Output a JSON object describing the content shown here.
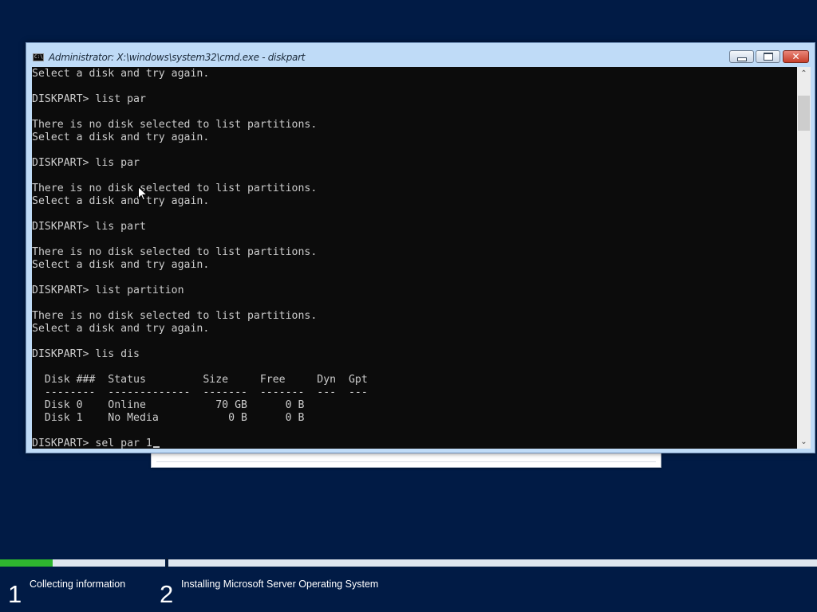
{
  "window": {
    "title": "Administrator: X:\\windows\\system32\\cmd.exe - diskpart",
    "icon": "cmd-app-icon",
    "minimize_icon": "minimize-icon",
    "maximize_icon": "maximize-icon",
    "close_icon": "close-icon"
  },
  "console": {
    "lines": [
      "Select a disk and try again.",
      "",
      "DISKPART> list par",
      "",
      "There is no disk selected to list partitions.",
      "Select a disk and try again.",
      "",
      "DISKPART> lis par",
      "",
      "There is no disk selected to list partitions.",
      "Select a disk and try again.",
      "",
      "DISKPART> lis part",
      "",
      "There is no disk selected to list partitions.",
      "Select a disk and try again.",
      "",
      "DISKPART> list partition",
      "",
      "There is no disk selected to list partitions.",
      "Select a disk and try again.",
      "",
      "DISKPART> lis dis",
      "",
      "  Disk ###  Status         Size     Free     Dyn  Gpt",
      "  --------  -------------  -------  -------  ---  ---",
      "  Disk 0    Online           70 GB      0 B",
      "  Disk 1    No Media           0 B      0 B",
      "",
      "DISKPART> sel par 1"
    ],
    "background": "#0c0c0c",
    "foreground": "#cccccc"
  },
  "scrollbar": {
    "up_icon": "scroll-up-arrow",
    "up_glyph": "⌃",
    "down_icon": "scroll-down-arrow",
    "down_glyph": "⌄"
  },
  "setup_steps": [
    {
      "number": "1",
      "label": "Collecting information",
      "progress": 0.32
    },
    {
      "number": "2",
      "label": "Installing Microsoft Server Operating System",
      "progress": 0
    }
  ],
  "colors": {
    "desktop_background": "#011b45",
    "progress_fill": "#2fb62f",
    "progress_track": "#dfe6ee",
    "close_button": "#c8402c"
  }
}
